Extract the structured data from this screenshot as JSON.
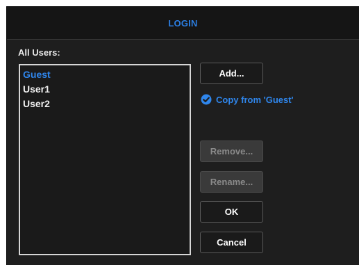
{
  "dialog": {
    "title": "LOGIN"
  },
  "users": {
    "label": "All Users:",
    "items": [
      "Guest",
      "User1",
      "User2"
    ],
    "selected": "Guest"
  },
  "buttons": {
    "add": "Add...",
    "remove": "Remove...",
    "rename": "Rename...",
    "ok": "OK",
    "cancel": "Cancel"
  },
  "copy_option": {
    "label": "Copy from 'Guest'",
    "checked": true,
    "icon": "check-circle-icon"
  },
  "colors": {
    "accent": "#2f86ec",
    "background": "#1e1e1e",
    "disabled_button": "#3a3a3a"
  }
}
